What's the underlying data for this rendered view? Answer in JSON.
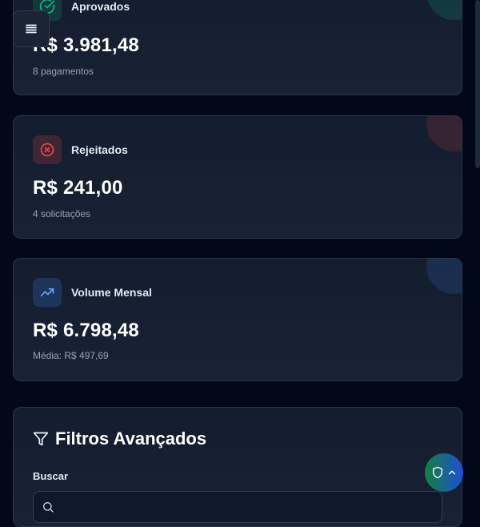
{
  "stats": [
    {
      "label": "Aprovados",
      "value": "R$ 3.981,48",
      "sub": "8 pagamentos",
      "icon": "check-circle-icon",
      "accent": "#10b981"
    },
    {
      "label": "Rejeitados",
      "value": "R$ 241,00",
      "sub": "4 solicitações",
      "icon": "x-circle-icon",
      "accent": "#ef4444"
    },
    {
      "label": "Volume Mensal",
      "value": "R$ 6.798,48",
      "sub": "Média: R$ 497,69",
      "icon": "trending-up-icon",
      "accent": "#3b82f6"
    }
  ],
  "filters": {
    "title": "Filtros Avançados",
    "search_label": "Buscar",
    "search_placeholder": "",
    "search_value": ""
  },
  "icons": {
    "menu": "menu-icon",
    "filter": "filter-icon",
    "search": "search-icon",
    "shield": "shield-icon",
    "chevron": "chevron-up-icon"
  }
}
